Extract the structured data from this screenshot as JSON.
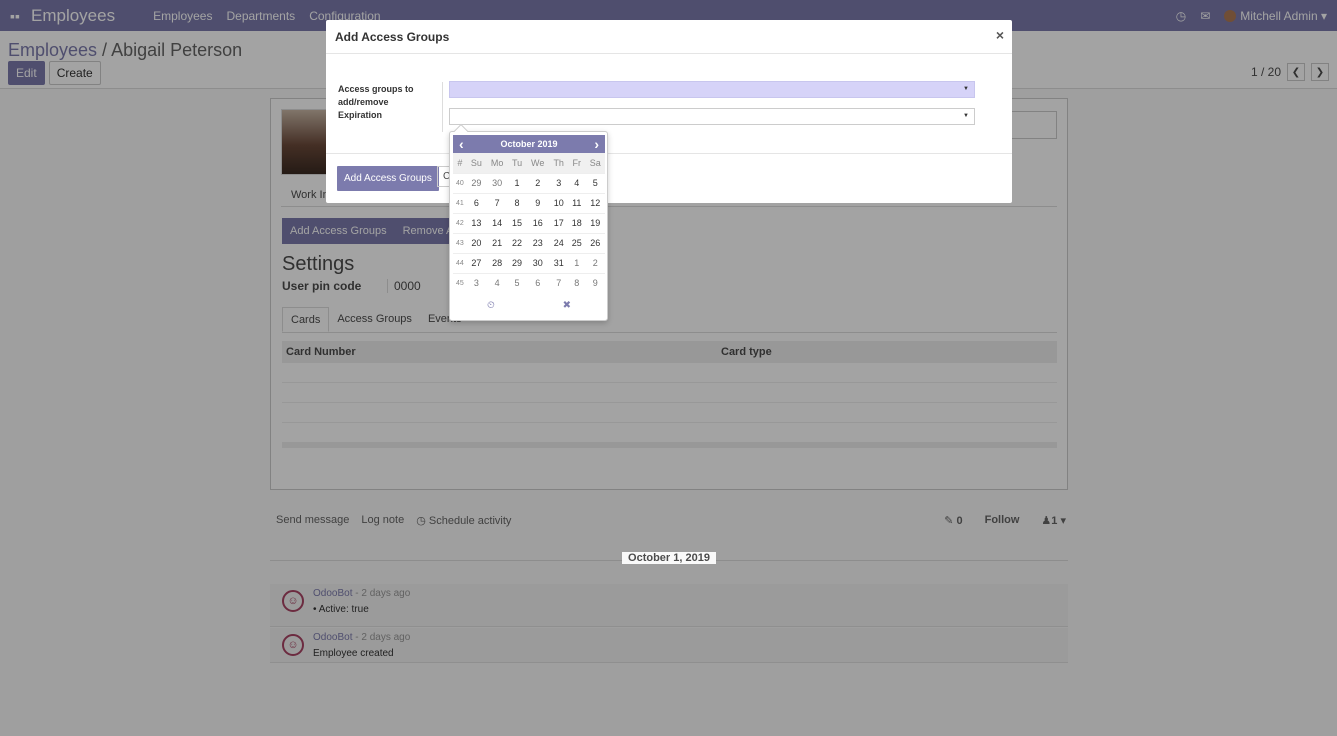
{
  "topbar": {
    "app_title": "Employees",
    "menu": [
      "Employees",
      "Departments",
      "Configuration"
    ],
    "user_name": "Mitchell Admin"
  },
  "control_panel": {
    "breadcrumb_parent": "Employees",
    "breadcrumb_sep": " / ",
    "breadcrumb_current": "Abigail Peterson",
    "edit_label": "Edit",
    "create_label": "Create",
    "pager_value": "1 / 20"
  },
  "form": {
    "work_info_tab": "Work Info",
    "add_access_groups_btn": "Add Access Groups",
    "remove_access_btn": "Remove Access",
    "settings_title": "Settings",
    "pin_label": "User pin code",
    "pin_value": "0000",
    "subtabs": [
      "Cards",
      "Access Groups",
      "Events"
    ],
    "table_headers": [
      "Card Number",
      "Card type"
    ]
  },
  "chatter": {
    "send_message": "Send message",
    "log_note": "Log note",
    "schedule_activity": "Schedule activity",
    "attachments_count": "0",
    "follow": "Follow",
    "followers_count": "1",
    "date_separator": "October 1, 2019",
    "messages": [
      {
        "author": "OdooBot",
        "ago": " - 2 days ago",
        "body": "Active: true"
      },
      {
        "author": "OdooBot",
        "ago": " - 2 days ago",
        "body": "Employee created"
      }
    ]
  },
  "modal": {
    "title": "Add Access Groups",
    "close_label": "×",
    "field_groups_label_1": "Access groups to",
    "field_groups_label_2": "add/remove",
    "field_expiration_label": "Expiration",
    "groups_value": "",
    "expiration_value": "",
    "submit_label": "Add Access Groups",
    "cancel_label": "C"
  },
  "datepicker": {
    "month_label": "October 2019",
    "prev": "‹",
    "next": "›",
    "week_header": "#",
    "day_headers": [
      "Su",
      "Mo",
      "Tu",
      "We",
      "Th",
      "Fr",
      "Sa"
    ],
    "weeks": [
      {
        "week": "40",
        "days": [
          "29",
          "30",
          "1",
          "2",
          "3",
          "4",
          "5"
        ]
      },
      {
        "week": "41",
        "days": [
          "6",
          "7",
          "8",
          "9",
          "10",
          "11",
          "12"
        ]
      },
      {
        "week": "42",
        "days": [
          "13",
          "14",
          "15",
          "16",
          "17",
          "18",
          "19"
        ]
      },
      {
        "week": "43",
        "days": [
          "20",
          "21",
          "22",
          "23",
          "24",
          "25",
          "26"
        ]
      },
      {
        "week": "44",
        "days": [
          "27",
          "28",
          "29",
          "30",
          "31",
          "1",
          "2"
        ]
      },
      {
        "week": "45",
        "days": [
          "3",
          "4",
          "5",
          "6",
          "7",
          "8",
          "9"
        ]
      }
    ],
    "footer_time_icon": "⏲",
    "footer_clear_icon": "✖"
  },
  "colors": {
    "brand": "#7c7bad",
    "selected_input": "#d6d3f8"
  }
}
